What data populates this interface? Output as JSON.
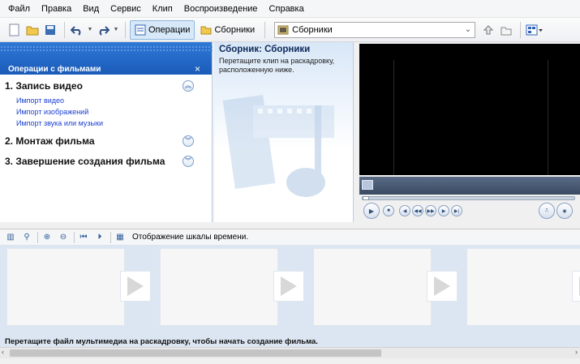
{
  "menu": [
    "Файл",
    "Правка",
    "Вид",
    "Сервис",
    "Клип",
    "Воспроизведение",
    "Справка"
  ],
  "toolbar": {
    "operations_label": "Операции",
    "collections_label": "Сборники",
    "collection_select_value": "Сборники"
  },
  "taskpane": {
    "title": "Операции с фильмами",
    "close": "×",
    "sections": [
      {
        "title": "1. Запись видео",
        "expanded": true,
        "links": [
          "Импорт видео",
          "Импорт изображений",
          "Импорт звука или музыки"
        ]
      },
      {
        "title": "2. Монтаж фильма",
        "expanded": false
      },
      {
        "title": "3. Завершение создания фильма",
        "expanded": false
      }
    ]
  },
  "collection": {
    "heading": "Сборник: Сборники",
    "description": "Перетащите клип на раскадровку, расположенную ниже."
  },
  "storyboard": {
    "show_timeline": "Отображение шкалы времени.",
    "hint": "Перетащите файл мультимедиа на раскадровку, чтобы начать создание фильма."
  },
  "icons": {
    "new": "new-project-icon",
    "open": "open-icon",
    "save": "save-icon",
    "undo": "undo-icon",
    "redo": "redo-icon"
  }
}
